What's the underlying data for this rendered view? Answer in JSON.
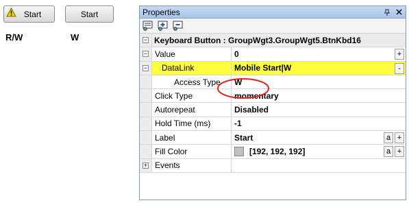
{
  "left": {
    "button1_label": "Start",
    "button2_label": "Start",
    "access1": "R/W",
    "access2": "W"
  },
  "properties": {
    "title": "Properties",
    "pin_glyph": "⩢",
    "close_glyph": "✕",
    "header": "Keyboard Button : GroupWgt3.GroupWgt5.BtnKbd16",
    "rows": {
      "value": {
        "name": "Value",
        "value": "0",
        "btn": "+"
      },
      "datalink": {
        "name": "DataLink",
        "value": "Mobile Start|W",
        "btn": "-"
      },
      "access": {
        "name": "Access Type",
        "value": "W"
      },
      "click": {
        "name": "Click Type",
        "value": "momentary"
      },
      "autorepeat": {
        "name": "Autorepeat",
        "value": "Disabled"
      },
      "hold": {
        "name": "Hold Time (ms)",
        "value": "-1"
      },
      "label": {
        "name": "Label",
        "value": "Start",
        "btn_a": "a",
        "btn_plus": "+"
      },
      "fill": {
        "name": "Fill Color",
        "value": "[192, 192, 192]",
        "btn_a": "a",
        "btn_plus": "+",
        "swatch": "#c0c0c0"
      },
      "events": {
        "name": "Events"
      }
    },
    "highlight_color": "#ffff40",
    "ellipse_color": "#e02020"
  }
}
